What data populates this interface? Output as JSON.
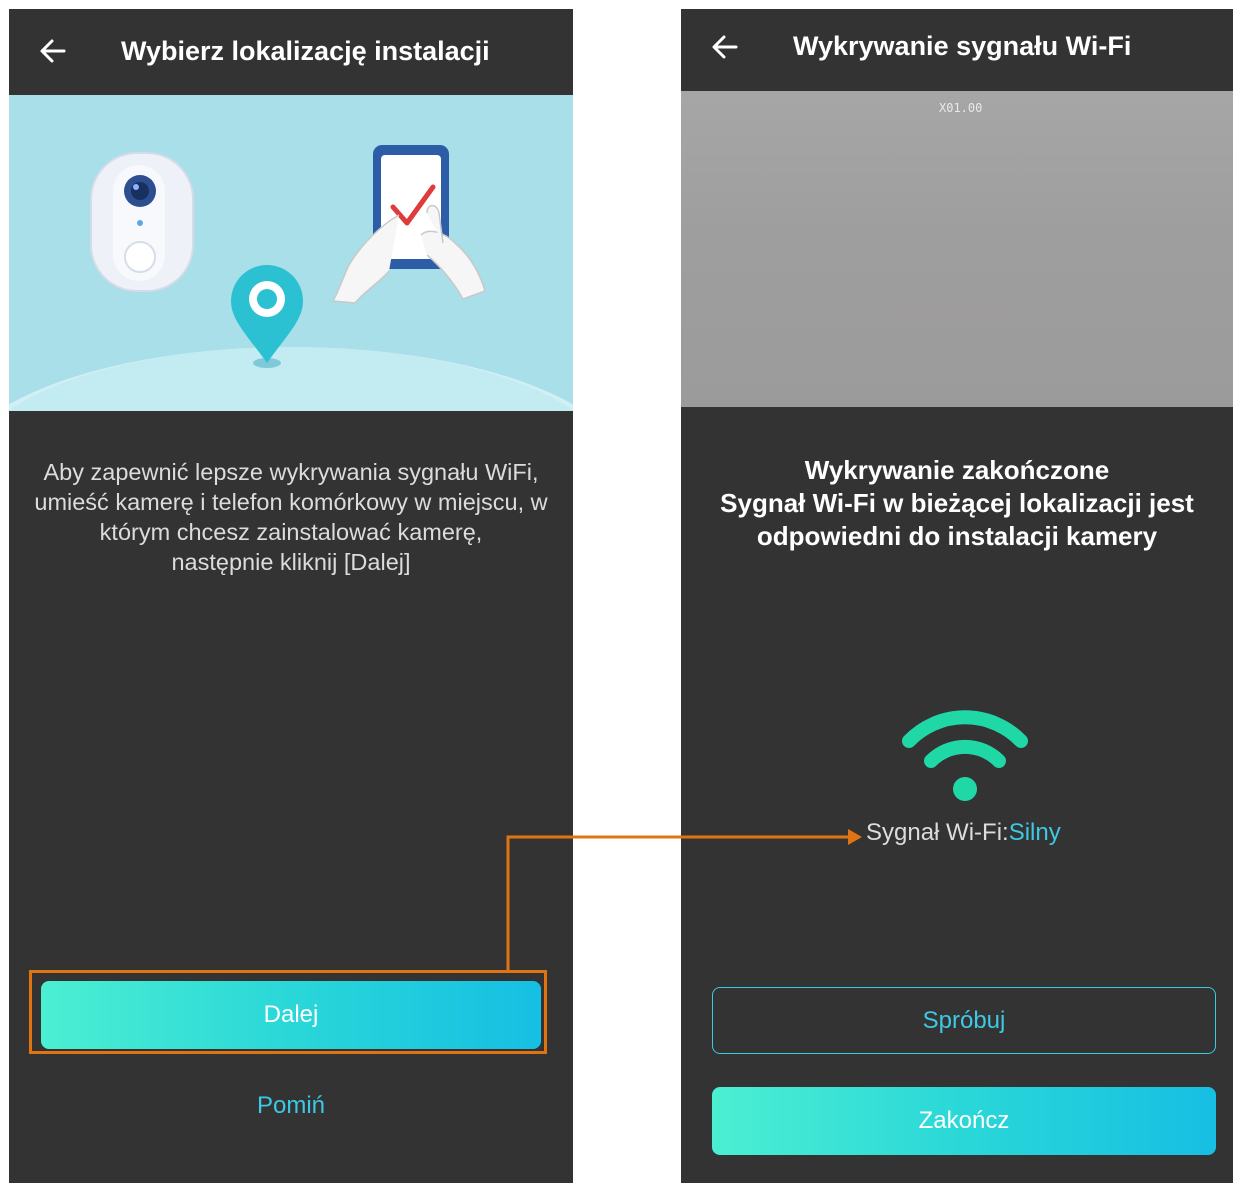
{
  "left_screen": {
    "header": {
      "title": "Wybierz lokalizację instalacji"
    },
    "description_lines": [
      "Aby zapewnić lepsze wykrywania sygnału WiFi,",
      "umieść kamerę i telefon komórkowy w miejscu, w",
      "którym chcesz zainstalować kamerę,",
      "następnie kliknij [Dalej]"
    ],
    "next_button": "Dalej",
    "skip_link": "Pomiń"
  },
  "right_screen": {
    "header": {
      "title": "Wykrywanie sygnału Wi-Fi"
    },
    "preview_stamp": "X01.00",
    "result_lines": [
      "Wykrywanie zakończone",
      "Sygnał Wi-Fi w bieżącej lokalizacji jest",
      "odpowiedni do instalacji kamery"
    ],
    "signal_label": "Sygnał Wi-Fi:",
    "signal_value": "Silny",
    "retry_button": "Spróbuj",
    "finish_button": "Zakończ"
  },
  "colors": {
    "background": "#333333",
    "accent": "#3dc8e4",
    "wifi": "#1fd8a6",
    "annotation": "#e07413",
    "button_gradient": [
      "#4cefd2",
      "#16bfe3"
    ]
  }
}
